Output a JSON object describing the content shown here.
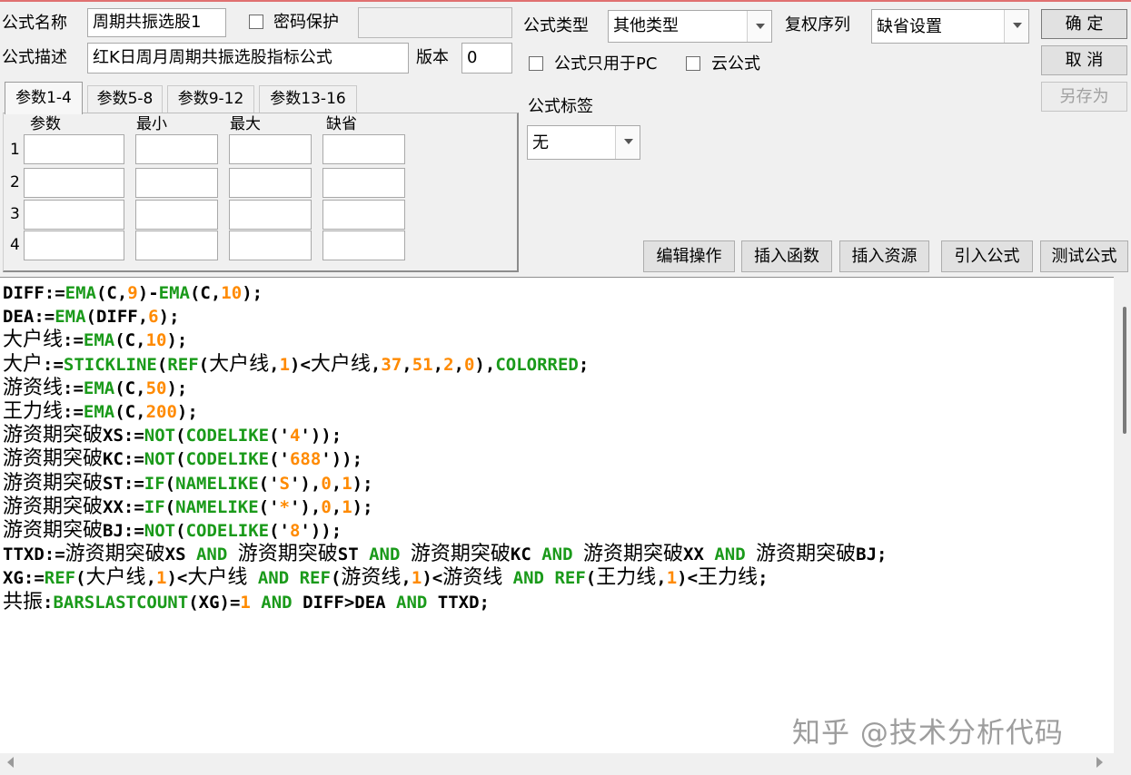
{
  "form": {
    "name_label": "公式名称",
    "name_value": "周期共振选股1",
    "password_label": "密码保护",
    "desc_label": "公式描述",
    "desc_value": "红K日周月周期共振选股指标公式",
    "version_label": "版本",
    "version_value": "0",
    "type_label": "公式类型",
    "type_value": "其他类型",
    "adjust_label": "复权序列",
    "adjust_value": "缺省设置",
    "pc_only_label": "公式只用于PC",
    "cloud_label": "云公式",
    "tag_label": "公式标签",
    "tag_value": "无"
  },
  "buttons": {
    "ok": "确 定",
    "cancel": "取 消",
    "save_as": "另存为",
    "edit_ops": "编辑操作",
    "insert_func": "插入函数",
    "insert_res": "插入资源",
    "import_formula": "引入公式",
    "test_formula": "测试公式"
  },
  "params": {
    "tabs": [
      "参数1-4",
      "参数5-8",
      "参数9-12",
      "参数13-16"
    ],
    "active_tab": 0,
    "columns": [
      "参数",
      "最小",
      "最大",
      "缺省"
    ],
    "rows": [
      "1",
      "2",
      "3",
      "4"
    ]
  },
  "code_lines": [
    [
      [
        "t",
        "DIFF:="
      ],
      [
        "f",
        "EMA"
      ],
      [
        "t",
        "(C,"
      ],
      [
        "n",
        "9"
      ],
      [
        "t",
        ")-"
      ],
      [
        "f",
        "EMA"
      ],
      [
        "t",
        "(C,"
      ],
      [
        "n",
        "10"
      ],
      [
        "t",
        ");"
      ]
    ],
    [
      [
        "t",
        "DEA:="
      ],
      [
        "f",
        "EMA"
      ],
      [
        "t",
        "(DIFF,"
      ],
      [
        "n",
        "6"
      ],
      [
        "t",
        ");"
      ]
    ],
    [
      [
        "c",
        "大户线"
      ],
      [
        "t",
        ":="
      ],
      [
        "f",
        "EMA"
      ],
      [
        "t",
        "(C,"
      ],
      [
        "n",
        "10"
      ],
      [
        "t",
        ");"
      ]
    ],
    [
      [
        "c",
        "大户"
      ],
      [
        "t",
        ":="
      ],
      [
        "f",
        "STICKLINE"
      ],
      [
        "t",
        "("
      ],
      [
        "f",
        "REF"
      ],
      [
        "t",
        "("
      ],
      [
        "c",
        "大户线"
      ],
      [
        "t",
        ","
      ],
      [
        "n",
        "1"
      ],
      [
        "t",
        ")<"
      ],
      [
        "c",
        "大户线"
      ],
      [
        "t",
        ","
      ],
      [
        "n",
        "37"
      ],
      [
        "t",
        ","
      ],
      [
        "n",
        "51"
      ],
      [
        "t",
        ","
      ],
      [
        "n",
        "2"
      ],
      [
        "t",
        ","
      ],
      [
        "n",
        "0"
      ],
      [
        "t",
        "),"
      ],
      [
        "f",
        "COLORRED"
      ],
      [
        "t",
        ";"
      ]
    ],
    [
      [
        "c",
        "游资线"
      ],
      [
        "t",
        ":="
      ],
      [
        "f",
        "EMA"
      ],
      [
        "t",
        "(C,"
      ],
      [
        "n",
        "50"
      ],
      [
        "t",
        ");"
      ]
    ],
    [
      [
        "c",
        "王力线"
      ],
      [
        "t",
        ":="
      ],
      [
        "f",
        "EMA"
      ],
      [
        "t",
        "(C,"
      ],
      [
        "n",
        "200"
      ],
      [
        "t",
        ");"
      ]
    ],
    [
      [
        "c",
        "游资期突破"
      ],
      [
        "t",
        "XS:="
      ],
      [
        "f",
        "NOT"
      ],
      [
        "t",
        "("
      ],
      [
        "f",
        "CODELIKE"
      ],
      [
        "t",
        "('"
      ],
      [
        "n",
        "4"
      ],
      [
        "t",
        "'));"
      ]
    ],
    [
      [
        "c",
        "游资期突破"
      ],
      [
        "t",
        "KC:="
      ],
      [
        "f",
        "NOT"
      ],
      [
        "t",
        "("
      ],
      [
        "f",
        "CODELIKE"
      ],
      [
        "t",
        "('"
      ],
      [
        "n",
        "688"
      ],
      [
        "t",
        "'));"
      ]
    ],
    [
      [
        "c",
        "游资期突破"
      ],
      [
        "t",
        "ST:="
      ],
      [
        "f",
        "IF"
      ],
      [
        "t",
        "("
      ],
      [
        "f",
        "NAMELIKE"
      ],
      [
        "t",
        "('"
      ],
      [
        "n",
        "S"
      ],
      [
        "t",
        "'),"
      ],
      [
        "n",
        "0"
      ],
      [
        "t",
        ","
      ],
      [
        "n",
        "1"
      ],
      [
        "t",
        ");"
      ]
    ],
    [
      [
        "c",
        "游资期突破"
      ],
      [
        "t",
        "XX:="
      ],
      [
        "f",
        "IF"
      ],
      [
        "t",
        "("
      ],
      [
        "f",
        "NAMELIKE"
      ],
      [
        "t",
        "('"
      ],
      [
        "n",
        "*"
      ],
      [
        "t",
        "'),"
      ],
      [
        "n",
        "0"
      ],
      [
        "t",
        ","
      ],
      [
        "n",
        "1"
      ],
      [
        "t",
        ");"
      ]
    ],
    [
      [
        "c",
        "游资期突破"
      ],
      [
        "t",
        "BJ:="
      ],
      [
        "f",
        "NOT"
      ],
      [
        "t",
        "("
      ],
      [
        "f",
        "CODELIKE"
      ],
      [
        "t",
        "('"
      ],
      [
        "n",
        "8"
      ],
      [
        "t",
        "'));"
      ]
    ],
    [
      [
        "t",
        "TTXD:="
      ],
      [
        "c",
        "游资期突破"
      ],
      [
        "t",
        "XS "
      ],
      [
        "f",
        "AND"
      ],
      [
        "t",
        " "
      ],
      [
        "c",
        "游资期突破"
      ],
      [
        "t",
        "ST "
      ],
      [
        "f",
        "AND"
      ],
      [
        "t",
        " "
      ],
      [
        "c",
        "游资期突破"
      ],
      [
        "t",
        "KC "
      ],
      [
        "f",
        "AND"
      ],
      [
        "t",
        " "
      ],
      [
        "c",
        "游资期突破"
      ],
      [
        "t",
        "XX "
      ],
      [
        "f",
        "AND"
      ],
      [
        "t",
        " "
      ],
      [
        "c",
        "游资期突破"
      ],
      [
        "t",
        "BJ;"
      ]
    ],
    [
      [
        "t",
        "XG:="
      ],
      [
        "f",
        "REF"
      ],
      [
        "t",
        "("
      ],
      [
        "c",
        "大户线"
      ],
      [
        "t",
        ","
      ],
      [
        "n",
        "1"
      ],
      [
        "t",
        ")<"
      ],
      [
        "c",
        "大户线"
      ],
      [
        "t",
        " "
      ],
      [
        "f",
        "AND"
      ],
      [
        "t",
        " "
      ],
      [
        "f",
        "REF"
      ],
      [
        "t",
        "("
      ],
      [
        "c",
        "游资线"
      ],
      [
        "t",
        ","
      ],
      [
        "n",
        "1"
      ],
      [
        "t",
        ")<"
      ],
      [
        "c",
        "游资线"
      ],
      [
        "t",
        " "
      ],
      [
        "f",
        "AND"
      ],
      [
        "t",
        " "
      ],
      [
        "f",
        "REF"
      ],
      [
        "t",
        "("
      ],
      [
        "c",
        "王力线"
      ],
      [
        "t",
        ","
      ],
      [
        "n",
        "1"
      ],
      [
        "t",
        ")<"
      ],
      [
        "c",
        "王力线"
      ],
      [
        "t",
        ";"
      ]
    ],
    [
      [
        "c",
        "共振"
      ],
      [
        "t",
        ":"
      ],
      [
        "f",
        "BARSLASTCOUNT"
      ],
      [
        "t",
        "(XG)="
      ],
      [
        "n",
        "1"
      ],
      [
        "t",
        " "
      ],
      [
        "f",
        "AND"
      ],
      [
        "t",
        " DIFF>DEA "
      ],
      [
        "f",
        "AND"
      ],
      [
        "t",
        " TTXD;"
      ]
    ]
  ],
  "watermark": "知乎 @技术分析代码",
  "colors": {
    "function": "#1a9a1a",
    "number": "#ff8a00",
    "text": "#000000"
  }
}
